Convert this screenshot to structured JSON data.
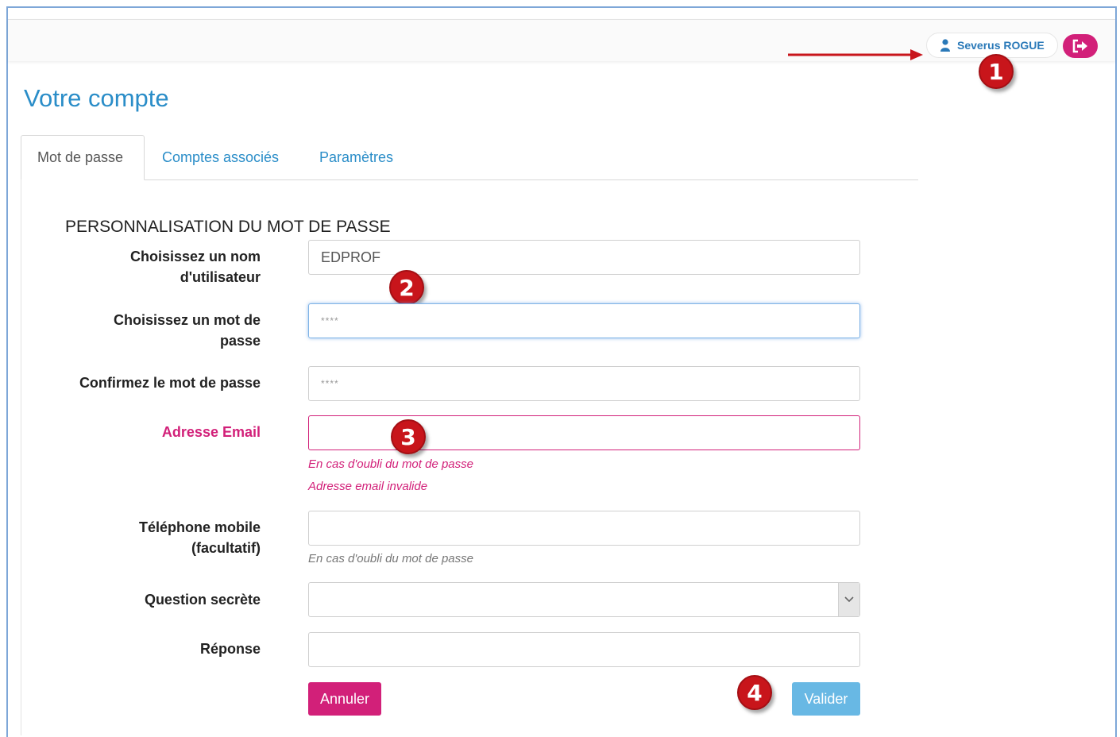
{
  "header": {
    "user_name": "Severus ROGUE",
    "user_icon": "user-icon",
    "logout_icon": "logout-icon",
    "accent": "#d22079"
  },
  "annotations": [
    "1",
    "2",
    "3",
    "4"
  ],
  "page": {
    "title": "Votre compte"
  },
  "tabs": [
    {
      "label": "Mot de passe",
      "active": true
    },
    {
      "label": "Comptes associés",
      "active": false
    },
    {
      "label": "Paramètres",
      "active": false
    }
  ],
  "form": {
    "section_title": "PERSONNALISATION DU MOT DE PASSE",
    "username": {
      "label_line1": "Choisissez un nom",
      "label_line2": "d'utilisateur",
      "value": "EDPROF"
    },
    "password": {
      "label_line1": "Choisissez un mot de",
      "label_line2": "passe",
      "value": "****"
    },
    "confirm": {
      "label": "Confirmez le mot de passe",
      "value": "****"
    },
    "email": {
      "label": "Adresse Email",
      "value": "",
      "help": "En cas d'oubli du mot de passe",
      "error": "Adresse email invalide"
    },
    "phone": {
      "label_line1": "Téléphone mobile",
      "label_line2": "(facultatif)",
      "value": "",
      "help": "En cas d'oubli du mot de passe"
    },
    "question": {
      "label": "Question secrète",
      "value": ""
    },
    "answer": {
      "label": "Réponse",
      "value": ""
    },
    "cancel_label": "Annuler",
    "submit_label": "Valider"
  },
  "colors": {
    "title_blue": "#2a8dc8",
    "error_pink": "#d22079",
    "submit_blue": "#68b8e4",
    "marker_red": "#c8151b"
  }
}
